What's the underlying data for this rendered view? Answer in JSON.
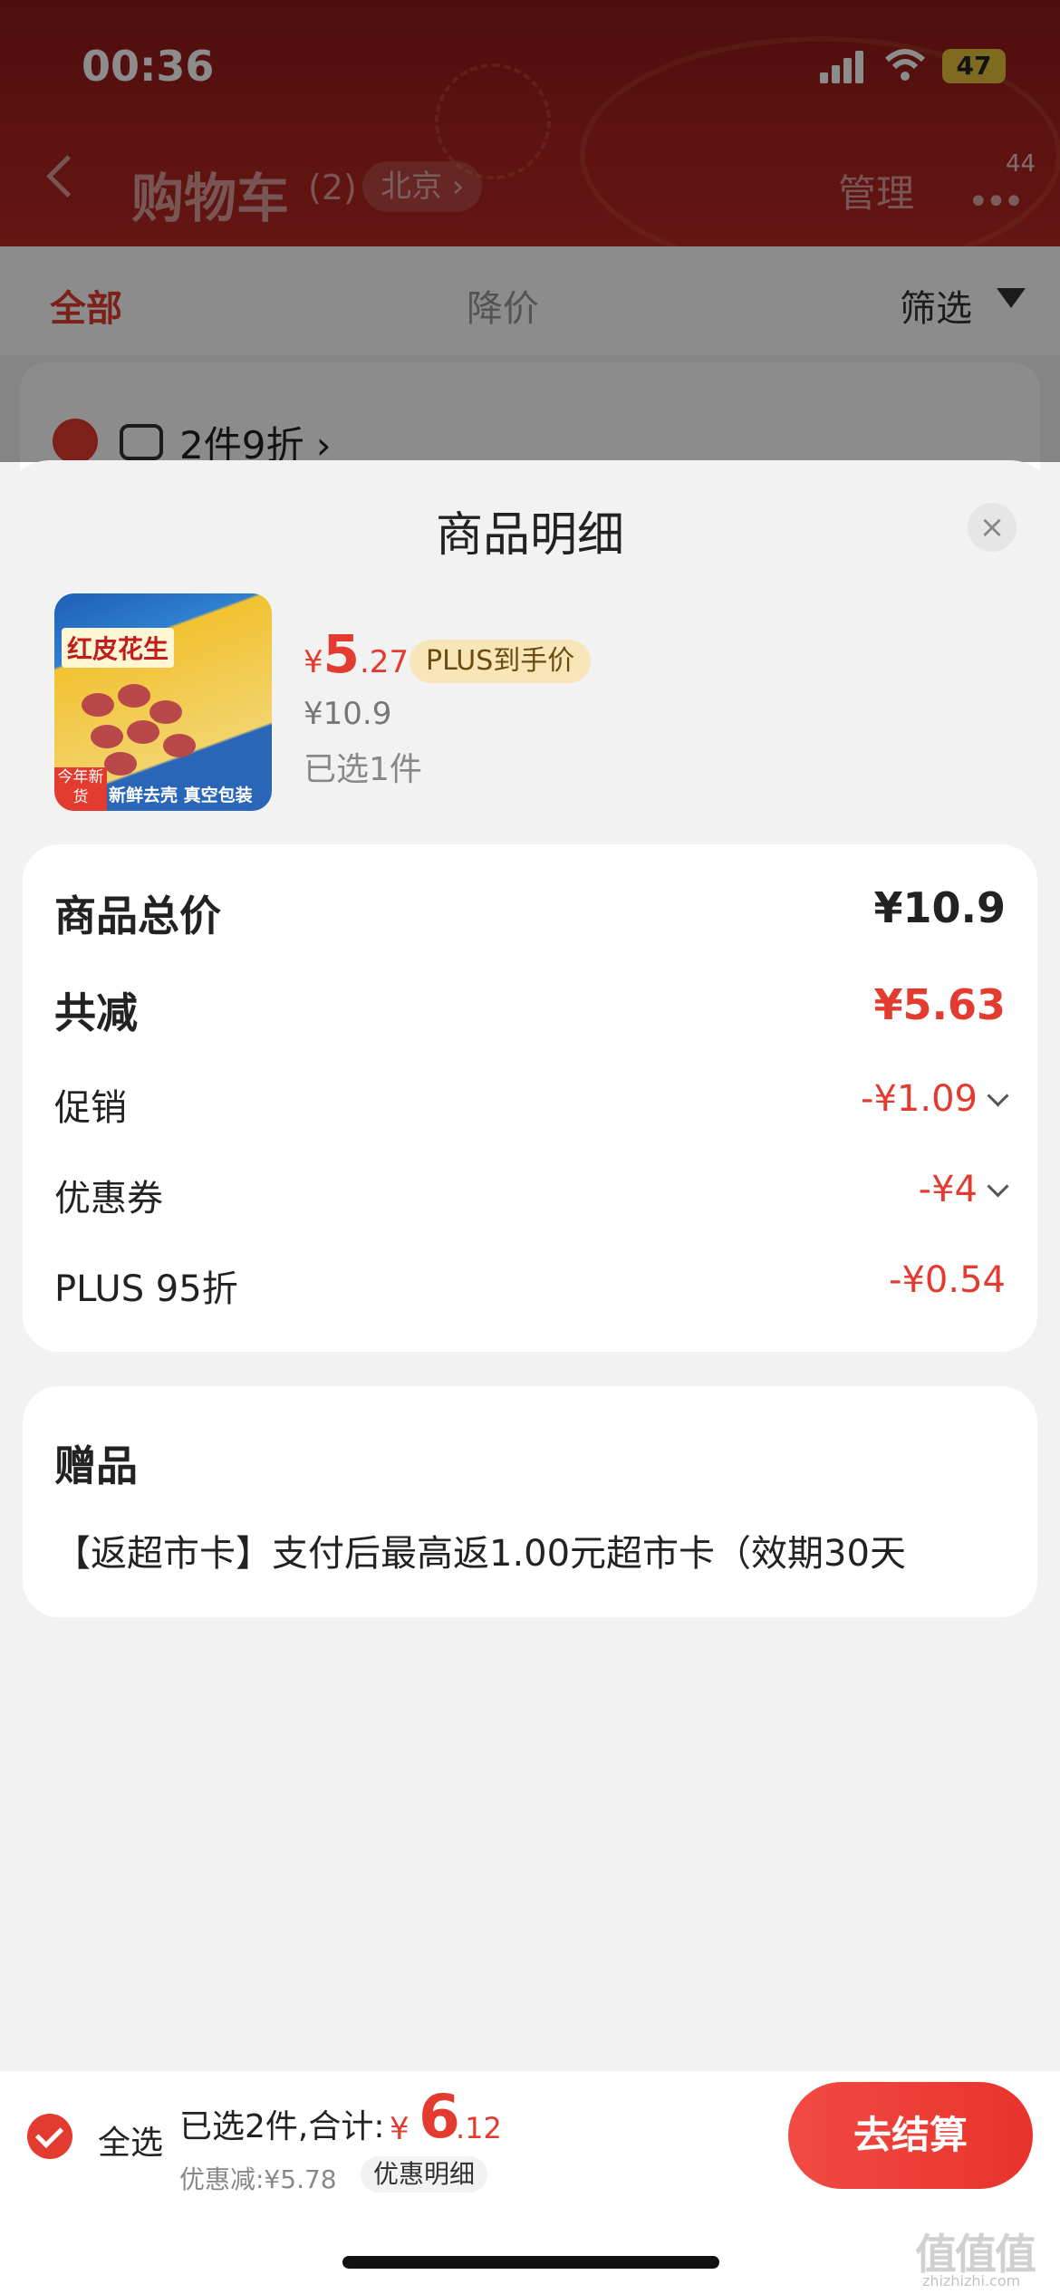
{
  "status_bar": {
    "time": "00:36",
    "battery": "47"
  },
  "nav": {
    "title": "购物车",
    "count": "(2)",
    "location": "北京 ›",
    "manage": "管理",
    "more": "•••",
    "more_badge": "44"
  },
  "filters": {
    "tab_all": "全部",
    "tab_price_drop": "降价",
    "filter_label": "筛选"
  },
  "cart_group": {
    "promo": "2件9折 ›"
  },
  "sheet": {
    "title": "商品明细",
    "close": "×",
    "product": {
      "image_title": "红皮花生",
      "image_banner": "新鲜去壳 真空包装",
      "image_new_tag": "今年新货",
      "price_yen": "¥",
      "price_int": "5",
      "price_dec": ".27",
      "plus_tag": "PLUS到手价",
      "original_price": "¥10.9",
      "selected": "已选1件"
    },
    "summary": {
      "total_label": "商品总价",
      "total_value": "¥10.9",
      "reduce_label": "共减",
      "reduce_value": "¥5.63",
      "promo_label": "促销",
      "promo_value": "-¥1.09",
      "coupon_label": "优惠券",
      "coupon_value": "-¥4",
      "plus_label": "PLUS 95折",
      "plus_value": "-¥0.54"
    },
    "gift": {
      "title": "赠品",
      "text": "【返超市卡】支付后最高返1.00元超市卡（效期30天"
    }
  },
  "bottom": {
    "select_all": "全选",
    "total_text": "已选2件,合计:",
    "total_yen": "¥",
    "total_int": "6",
    "total_dec": ".12",
    "discount": "优惠减:¥5.78",
    "detail_button": "优惠明细",
    "checkout": "去结算"
  },
  "watermark": {
    "main": "值值值",
    "sub": "zhizhizhi.com"
  },
  "colors": {
    "accent": "#e33b2f",
    "header": "#a8231f",
    "plus_tag_bg": "#f8e6b8"
  },
  "icons": [
    "back-icon",
    "funnel-icon",
    "store-icon",
    "close-icon",
    "chevron-down-icon",
    "check-icon",
    "signal-icon",
    "wifi-icon"
  ]
}
